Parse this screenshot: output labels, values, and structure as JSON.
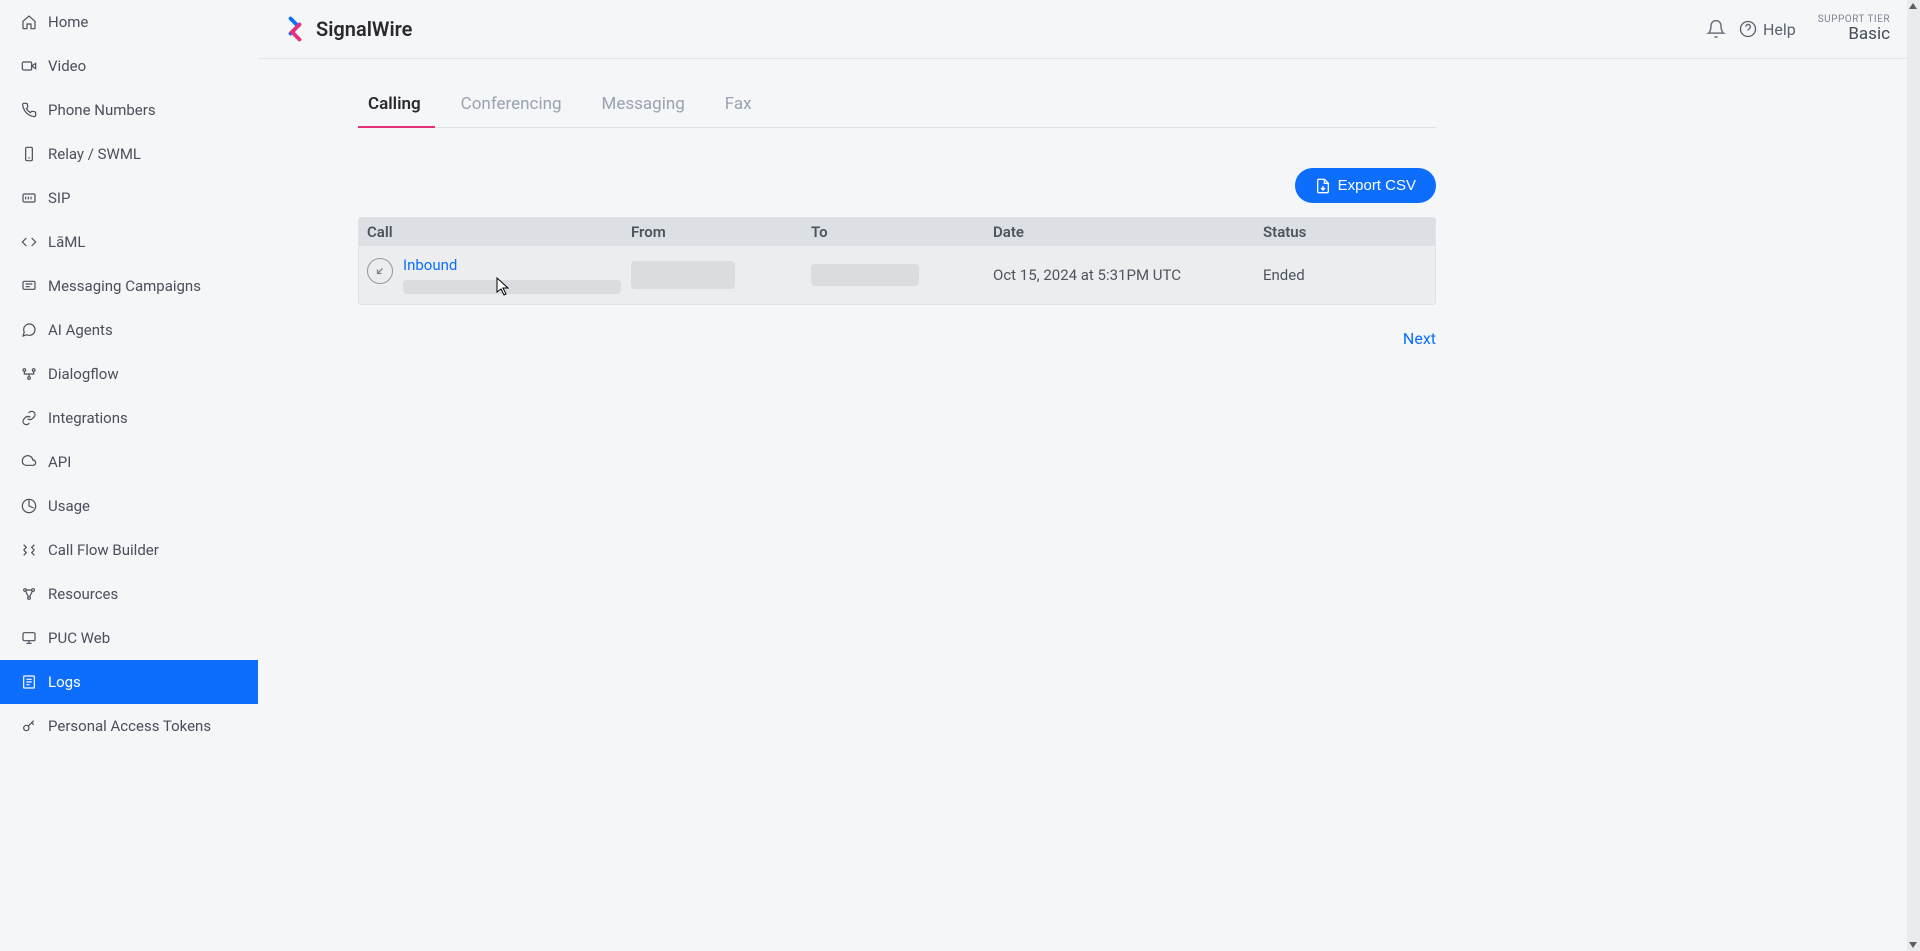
{
  "brand": "SignalWire",
  "header": {
    "help_label": "Help",
    "support_tier_label": "SUPPORT TIER",
    "support_tier_value": "Basic"
  },
  "sidebar": {
    "items": [
      {
        "label": "Home",
        "icon": "home-icon"
      },
      {
        "label": "Video",
        "icon": "video-icon"
      },
      {
        "label": "Phone Numbers",
        "icon": "phone-icon"
      },
      {
        "label": "Relay / SWML",
        "icon": "relay-icon"
      },
      {
        "label": "SIP",
        "icon": "sip-icon"
      },
      {
        "label": "LāML",
        "icon": "laml-icon"
      },
      {
        "label": "Messaging Campaigns",
        "icon": "messaging-icon"
      },
      {
        "label": "AI Agents",
        "icon": "ai-icon"
      },
      {
        "label": "Dialogflow",
        "icon": "dialogflow-icon"
      },
      {
        "label": "Integrations",
        "icon": "integrations-icon"
      },
      {
        "label": "API",
        "icon": "api-icon"
      },
      {
        "label": "Usage",
        "icon": "usage-icon"
      },
      {
        "label": "Call Flow Builder",
        "icon": "flow-icon"
      },
      {
        "label": "Resources",
        "icon": "resources-icon"
      },
      {
        "label": "PUC Web",
        "icon": "puc-icon"
      },
      {
        "label": "Logs",
        "icon": "logs-icon",
        "active": true
      },
      {
        "label": "Personal Access Tokens",
        "icon": "token-icon"
      }
    ]
  },
  "tabs": [
    {
      "label": "Calling",
      "active": true
    },
    {
      "label": "Conferencing"
    },
    {
      "label": "Messaging"
    },
    {
      "label": "Fax"
    }
  ],
  "toolbar": {
    "export_label": "Export CSV"
  },
  "table": {
    "columns": [
      "Call",
      "From",
      "To",
      "Date",
      "Status"
    ],
    "rows": [
      {
        "direction": "Inbound",
        "date": "Oct 15, 2024 at 5:31PM UTC",
        "status": "Ended"
      }
    ]
  },
  "pagination": {
    "next_label": "Next"
  }
}
